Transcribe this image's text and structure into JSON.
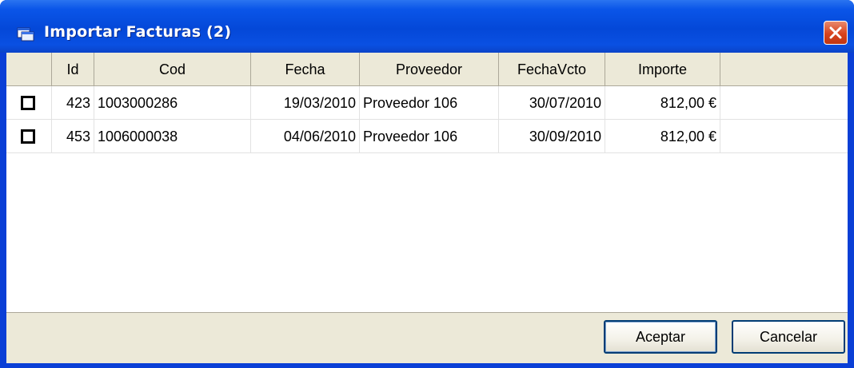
{
  "window": {
    "title": "Importar Facturas (2)",
    "close_label": "close"
  },
  "table": {
    "columns": [
      "",
      "Id",
      "Cod",
      "Fecha",
      "Proveedor",
      "FechaVcto",
      "Importe"
    ],
    "rows": [
      {
        "checked": false,
        "id": "423",
        "cod": "1003000286",
        "fecha": "19/03/2010",
        "proveedor": "Proveedor 106",
        "fecha_vcto": "30/07/2010",
        "importe": "812,00 €"
      },
      {
        "checked": false,
        "id": "453",
        "cod": "1006000038",
        "fecha": "04/06/2010",
        "proveedor": "Proveedor 106",
        "fecha_vcto": "30/09/2010",
        "importe": "812,00 €"
      }
    ]
  },
  "buttons": {
    "accept": "Aceptar",
    "cancel": "Cancelar"
  },
  "colors": {
    "titlebar": "#0448d8",
    "close": "#d8431d",
    "face": "#ece9d8"
  }
}
